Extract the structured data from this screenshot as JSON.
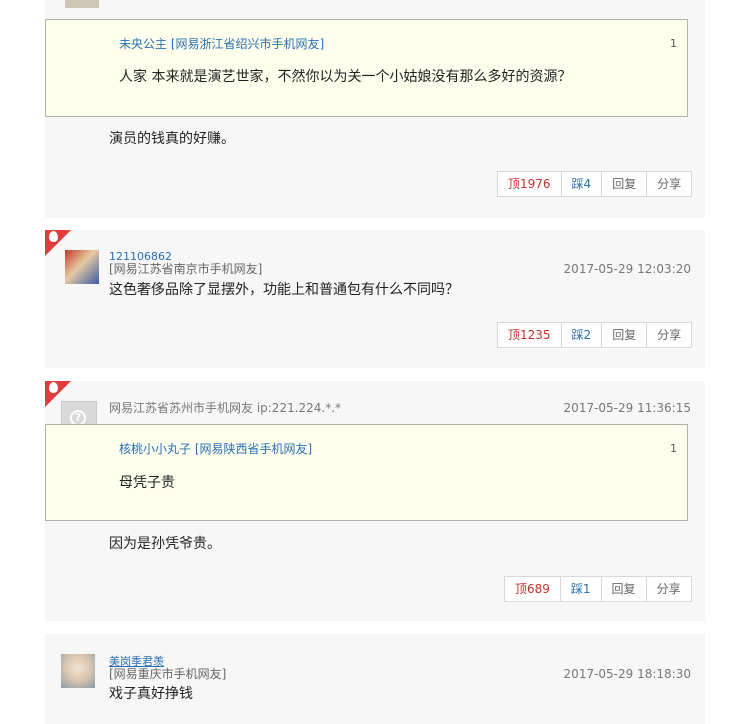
{
  "comments": [
    {
      "quote": {
        "user": "未央公主",
        "location": "[网易浙江省绍兴市手机网友]",
        "floor": "1",
        "text": "人家  本来就是演艺世家，不然你以为关一个小姑娘没有那么多好的资源？"
      },
      "text": "演员的钱真的好赚。",
      "actions": {
        "up": "顶1976",
        "down": "踩4",
        "reply": "回复",
        "share": "分享"
      }
    },
    {
      "hot": true,
      "username": "121106862",
      "location": "[网易江苏省南京市手机网友]",
      "timestamp": "2017-05-29 12:03:20",
      "text": "这色奢侈品除了显摆外，功能上和普通包有什么不同吗？",
      "actions": {
        "up": "顶1235",
        "down": "踩2",
        "reply": "回复",
        "share": "分享"
      }
    },
    {
      "hot": true,
      "location": "网易江苏省苏州市手机网友  ip:221.224.*.*",
      "timestamp": "2017-05-29 11:36:15",
      "quote": {
        "user": "核桃小小丸子",
        "location": "[网易陕西省手机网友]",
        "floor": "1",
        "text": "母凭子贵"
      },
      "text": "因为是孙凭爷贵。",
      "actions": {
        "up": "顶689",
        "down": "踩1",
        "reply": "回复",
        "share": "分享"
      }
    },
    {
      "username": "美岗季君羡",
      "location": "[网易重庆市手机网友]",
      "timestamp": "2017-05-29 18:18:30",
      "text": "戏子真好挣钱"
    }
  ]
}
